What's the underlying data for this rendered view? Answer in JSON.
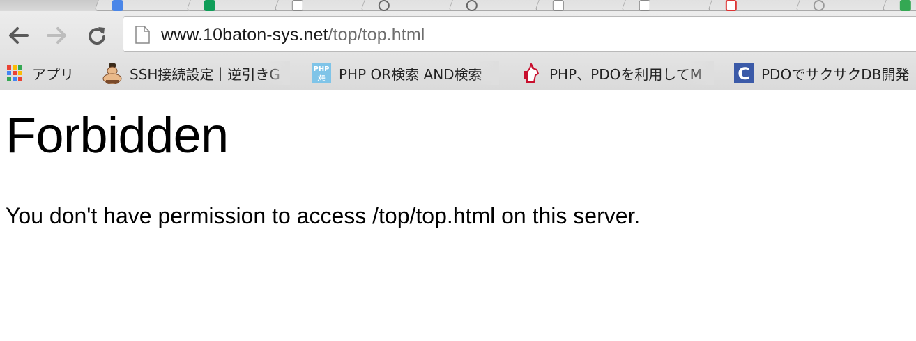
{
  "browser": {
    "address_bar": {
      "host": "www.10baton-sys.net",
      "path": "/top/top.html"
    },
    "nav": {
      "back_icon": "arrow-left-icon",
      "forward_icon": "arrow-right-icon",
      "reload_icon": "reload-icon",
      "page_icon": "document-icon"
    },
    "bookmarks": [
      {
        "label": "アプリ",
        "icon": "apps-grid-icon"
      },
      {
        "label": "SSH接続設定｜逆引きG",
        "icon": "sumo-wrestler-icon"
      },
      {
        "label": "PHP OR検索 AND検索",
        "icon": "php-memo-icon"
      },
      {
        "label": "PHP、PDOを利用してM",
        "icon": "unicorn-icon"
      },
      {
        "label": "PDOでサクサクDB開発",
        "icon": "letter-c-icon"
      }
    ]
  },
  "page": {
    "title": "Forbidden",
    "message": "You don't have permission to access /top/top.html on this server."
  }
}
